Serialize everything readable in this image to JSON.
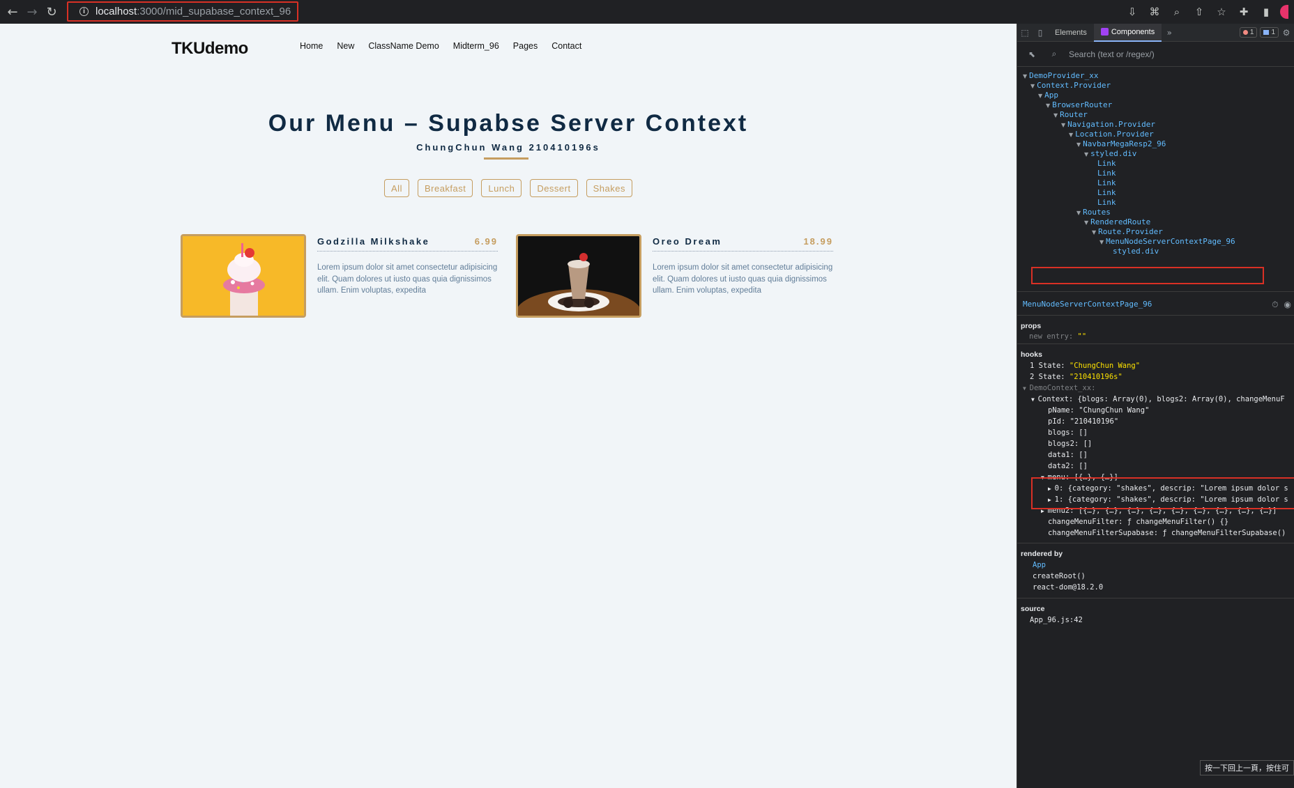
{
  "browser": {
    "url_host": "localhost",
    "url_rest": ":3000/mid_supabase_context_96"
  },
  "page": {
    "brand": "TKUdemo",
    "nav": [
      "Home",
      "New",
      "ClassName Demo",
      "Midterm_96",
      "Pages",
      "Contact"
    ],
    "title": "Our Menu – Supabse Server Context",
    "subtitle": "ChungChun Wang 210410196s",
    "filters": [
      "All",
      "Breakfast",
      "Lunch",
      "Dessert",
      "Shakes"
    ],
    "items": [
      {
        "name": "Godzilla Milkshake",
        "price": "6.99",
        "desc": "Lorem ipsum dolor sit amet consectetur adipisicing elit. Quam dolores ut iusto quas quia dignissimos ullam. Enim voluptas, expedita"
      },
      {
        "name": "Oreo Dream",
        "price": "18.99",
        "desc": "Lorem ipsum dolor sit amet consectetur adipisicing elit. Quam dolores ut iusto quas quia dignissimos ullam. Enim voluptas, expedita"
      }
    ]
  },
  "devtools": {
    "tabs": {
      "elements": "Elements",
      "components": "Components"
    },
    "badges": {
      "errors": "1",
      "messages": "1"
    },
    "search_placeholder": "Search (text or /regex/)",
    "tree": [
      "DemoProvider_xx",
      "Context.Provider",
      "App",
      "BrowserRouter",
      "Router",
      "Navigation.Provider",
      "Location.Provider",
      "NavbarMegaResp2_96",
      "styled.div",
      "Link",
      "Link",
      "Link",
      "Link",
      "Link",
      "Routes",
      "RenderedRoute",
      "Route.Provider",
      "MenuNodeServerContextPage_96",
      "styled.div"
    ],
    "selected_component": "MenuNodeServerContextPage_96",
    "props_label": "props",
    "props_line": "new entry: \"\"",
    "hooks_label": "hooks",
    "hooks": [
      {
        "num": "1",
        "name": "State:",
        "value": "\"ChungChun Wang\""
      },
      {
        "num": "2",
        "name": "State:",
        "value": "\"210410196s\""
      }
    ],
    "context_name": "DemoContext_xx:",
    "context_lines": [
      "Context: {blogs: Array(0), blogs2: Array(0), changeMenuF",
      "pName: \"ChungChun Wang\"",
      "pId: \"210410196\"",
      "blogs: []",
      "blogs2: []",
      "data1: []",
      "data2: []",
      "menu: [{…}, {…}]",
      "0: {category: \"shakes\", descrip: \"Lorem ipsum dolor s",
      "1: {category: \"shakes\", descrip: \"Lorem ipsum dolor s",
      "menu2: [{…}, {…}, {…}, {…}, {…}, {…}, {…}, {…}, {…}]",
      "changeMenuFilter: ƒ changeMenuFilter() {}",
      "changeMenuFilterSupabase: ƒ changeMenuFilterSupabase()"
    ],
    "rendered_by_label": "rendered by",
    "rendered_by": [
      "App",
      "createRoot()",
      "react-dom@18.2.0"
    ],
    "source_label": "source",
    "source": "App_96.js:42",
    "footer_tip": "按一下回上一頁，按住可"
  }
}
